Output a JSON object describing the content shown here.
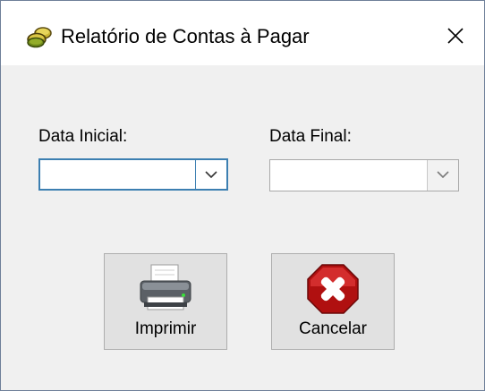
{
  "window": {
    "title": "Relatório de Contas à Pagar",
    "icon": "coins-icon",
    "close_icon": "close-icon"
  },
  "form": {
    "data_inicial": {
      "label": "Data Inicial:",
      "value": ""
    },
    "data_final": {
      "label": "Data Final:",
      "value": ""
    }
  },
  "buttons": {
    "imprimir": {
      "label": "Imprimir",
      "icon": "printer-icon"
    },
    "cancelar": {
      "label": "Cancelar",
      "icon": "cancel-x-icon"
    }
  },
  "colors": {
    "focus_border": "#3c7fb1",
    "button_face": "#e1e1e1",
    "window_border": "#6e7f99",
    "cancel_red": "#d01818"
  }
}
